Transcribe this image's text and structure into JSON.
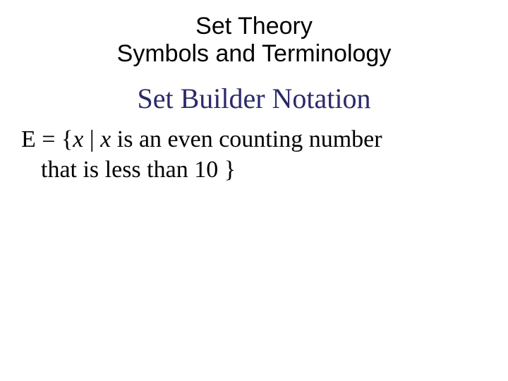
{
  "title": {
    "line1": "Set Theory",
    "line2": "Symbols and Terminology"
  },
  "subtitle": "Set Builder Notation",
  "definition": {
    "prefix": "E = {",
    "var1": "x",
    "bar": " | ",
    "var2": "x",
    "mid": " is an even counting number",
    "line2": "that is less than 10 }"
  }
}
